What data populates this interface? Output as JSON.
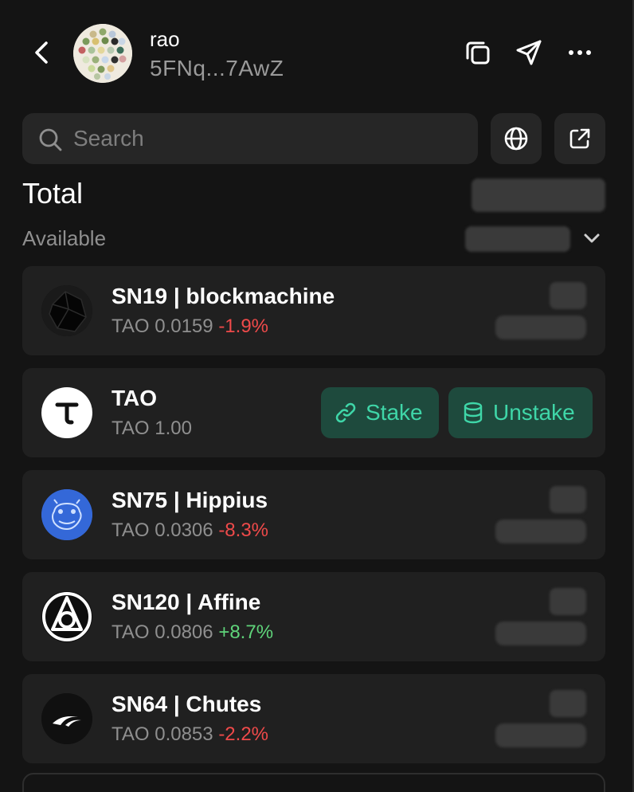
{
  "header": {
    "account_name": "rao",
    "account_address": "5FNq...7AwZ"
  },
  "search": {
    "placeholder": "Search"
  },
  "summary": {
    "total_label": "Total",
    "available_label": "Available"
  },
  "tokens": [
    {
      "name": "SN19 | blockmachine",
      "price": "TAO 0.0159",
      "change": "-1.9%",
      "icon": "blockmachine-icon"
    },
    {
      "name": "TAO",
      "price": "TAO 1.00",
      "icon": "tao-icon"
    },
    {
      "name": "SN75 | Hippius",
      "price": "TAO 0.0306",
      "change": "-8.3%",
      "icon": "hippius-icon"
    },
    {
      "name": "SN120 | Affine",
      "price": "TAO 0.0806",
      "change": "+8.7%",
      "icon": "affine-icon"
    },
    {
      "name": "SN64 | Chutes",
      "price": "TAO 0.0853",
      "change": "-2.2%",
      "icon": "chutes-icon"
    }
  ],
  "actions": {
    "stake": "Stake",
    "unstake": "Unstake"
  },
  "colors": {
    "background": "#141414",
    "card": "#202020",
    "negative": "#ef4a4a",
    "positive": "#5fd47a",
    "accent": "#3fd6a8",
    "accent_bg": "#1e4a3d"
  }
}
